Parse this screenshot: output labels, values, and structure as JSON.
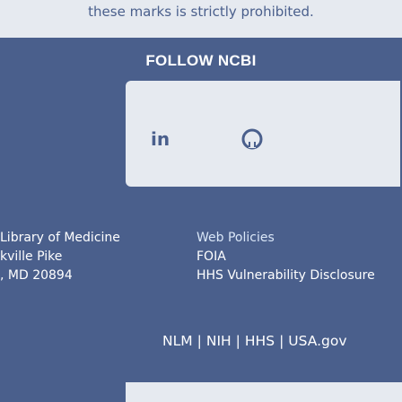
{
  "notice": {
    "text": "these marks is strictly prohibited."
  },
  "follow": {
    "heading": "FOLLOW NCBI",
    "icons": [
      "linkedin-icon",
      "github-icon"
    ],
    "linkedin_glyph": "in"
  },
  "address": {
    "line1": "Library of Medicine",
    "line2": "kville Pike",
    "line3": ", MD 20894"
  },
  "links": {
    "web_policies": "Web Policies",
    "foia": "FOIA",
    "hhs_vdp": "HHS Vulnerability Disclosure"
  },
  "agency_nav": {
    "nlm": "NLM",
    "nih": "NIH",
    "hhs": "HHS",
    "usa": "USA.gov",
    "separator": "|"
  },
  "colors": {
    "background": "#4a5f8c",
    "panel": "#e6eaf0",
    "text": "#ffffff"
  }
}
